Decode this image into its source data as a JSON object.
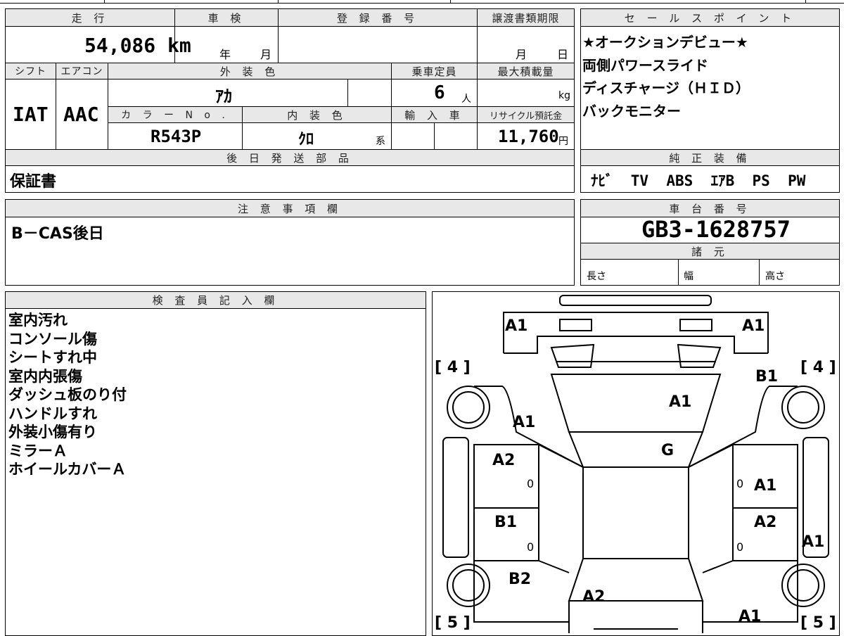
{
  "labels": {
    "mileage": "走 行",
    "inspection": "車 検",
    "registration": "登 録 番 号",
    "transfer_deadline": "譲渡書類期限",
    "shift": "シフト",
    "aircon": "エアコン",
    "exterior_color": "外 装 色",
    "capacity": "乗車定員",
    "max_load": "最大積載量",
    "color_no": "カ ラ ー N o .",
    "interior_color": "内 装 色",
    "import": "輸 入 車",
    "recycle": "リサイクル預託金",
    "later_parts": "後 日 発 送 部 品",
    "sales_point": "セ ー ル ス ポ イ ン ト",
    "genuine_equipment": "純 正 装 備",
    "notes": "注 意 事 項 欄",
    "chassis_no": "車 台 番 号",
    "specs": "諸 元",
    "inspector": "検 査 員 記 入 欄"
  },
  "values": {
    "mileage": "54,086 km",
    "year_unit": "年",
    "month_unit": "月",
    "transfer_month": "月",
    "transfer_day": "日",
    "shift": "IAT",
    "aircon": "AAC",
    "exterior_color": "ｱｶ",
    "capacity": "6",
    "capacity_unit": "人",
    "max_load_unit": "kg",
    "color_no": "R543P",
    "interior_color": "ｸﾛ",
    "interior_suffix": "系",
    "recycle": "11,760",
    "recycle_unit": "円",
    "later_parts": "保証書",
    "genuine_equipment": "ﾅﾋﾞ  TV  ABS  ｴｱB  PS  PW",
    "notes": "B－CAS後日",
    "chassis_no": "GB3-1628757",
    "length_label": "長さ",
    "width_label": "幅",
    "height_label": "高さ"
  },
  "sales_points": [
    "★オークションデビュー★",
    "両側パワースライド",
    "ディスチャージ（ＨＩＤ）",
    "バックモニター"
  ],
  "inspector_notes": [
    "室内汚れ",
    "コンソール傷",
    "シートすれ中",
    "室内内張傷",
    "ダッシュ板のり付",
    "ハンドルすれ",
    "外装小傷有り",
    "ミラーＡ",
    "ホイールカバーＡ"
  ],
  "diagram": {
    "front_left_bracket": "[ 4 ]",
    "front_right_bracket": "[ 4 ]",
    "rear_left_bracket": "[ 5 ]",
    "rear_right_bracket": "[ 5 ]",
    "marks": {
      "front_bumper_left": "A1",
      "front_bumper_right": "A1",
      "right_front_fender": "B1",
      "hood": "A1",
      "left_front_fender": "A1",
      "windshield": "G",
      "left_front_door": "A2",
      "right_front_door": "A1",
      "left_rear_door": "B1",
      "right_rear_door": "A2",
      "right_step": "A1",
      "left_quarter": "B2",
      "rear_glass": "A2",
      "rear_right": "A1",
      "zero_1": "0",
      "zero_2": "0",
      "zero_3": "0",
      "zero_4": "0"
    }
  }
}
